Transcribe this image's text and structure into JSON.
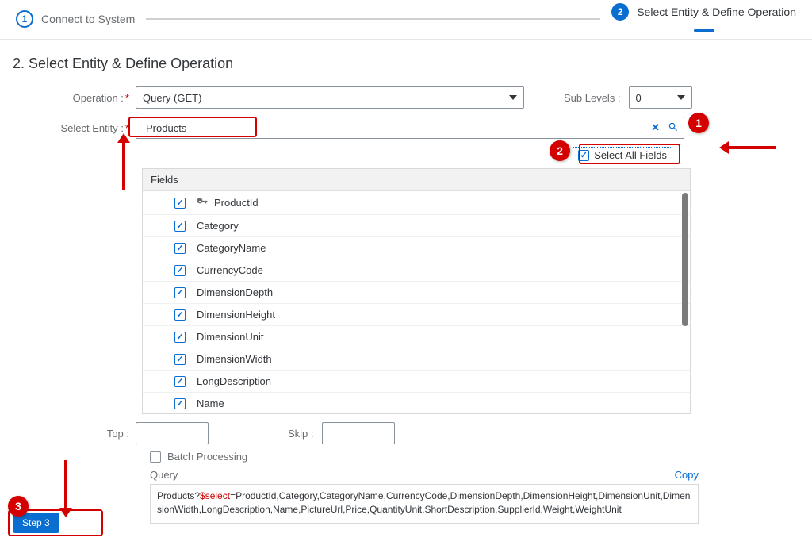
{
  "wizard": {
    "steps": [
      {
        "num": "1",
        "label": "Connect to System"
      },
      {
        "num": "2",
        "label": "Select Entity & Define Operation"
      }
    ]
  },
  "section_title": "2. Select Entity & Define Operation",
  "labels": {
    "operation": "Operation :",
    "select_entity": "Select Entity :",
    "sub_levels": "Sub Levels :",
    "top": "Top :",
    "skip": "Skip :",
    "batch": "Batch Processing",
    "query": "Query",
    "copy": "Copy",
    "select_all": "Select All Fields",
    "fields_header": "Fields"
  },
  "operation_value": "Query (GET)",
  "entity_value": "Products",
  "sublevels_value": "0",
  "top_value": "",
  "skip_value": "",
  "batch_checked": false,
  "select_all_checked": true,
  "fields": [
    {
      "name": "ProductId",
      "checked": true,
      "key": true
    },
    {
      "name": "Category",
      "checked": true,
      "key": false
    },
    {
      "name": "CategoryName",
      "checked": true,
      "key": false
    },
    {
      "name": "CurrencyCode",
      "checked": true,
      "key": false
    },
    {
      "name": "DimensionDepth",
      "checked": true,
      "key": false
    },
    {
      "name": "DimensionHeight",
      "checked": true,
      "key": false
    },
    {
      "name": "DimensionUnit",
      "checked": true,
      "key": false
    },
    {
      "name": "DimensionWidth",
      "checked": true,
      "key": false
    },
    {
      "name": "LongDescription",
      "checked": true,
      "key": false
    },
    {
      "name": "Name",
      "checked": true,
      "key": false
    }
  ],
  "query_prefix": "Products?",
  "query_select_kw": "$select",
  "query_rest": "=ProductId,Category,CategoryName,CurrencyCode,DimensionDepth,DimensionHeight,DimensionUnit,DimensionWidth,LongDescription,Name,PictureUrl,Price,QuantityUnit,ShortDescription,SupplierId,Weight,WeightUnit",
  "step3_label": "Step 3",
  "callouts": {
    "c1": "1",
    "c2": "2",
    "c3": "3"
  }
}
